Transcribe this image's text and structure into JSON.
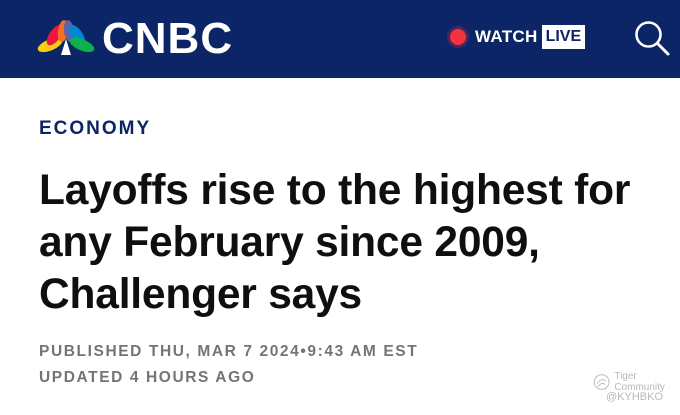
{
  "header": {
    "brand_name": "CNBC",
    "watch_label": "WATCH",
    "live_label": "LIVE",
    "background_color": "#0b2566",
    "live_dot_color": "#f5333f",
    "icons": [
      "nbc-peacock-logo-icon",
      "live-dot-icon",
      "search-icon"
    ]
  },
  "article": {
    "section": "ECONOMY",
    "headline": "Layoffs rise to the highest for any February since 2009, Challenger says",
    "published": "PUBLISHED THU, MAR 7 2024•9:43 AM EST",
    "updated": "UPDATED 4 HOURS AGO"
  },
  "watermarks": {
    "community": "Tiger Community",
    "handle": "@KYHBKO"
  }
}
